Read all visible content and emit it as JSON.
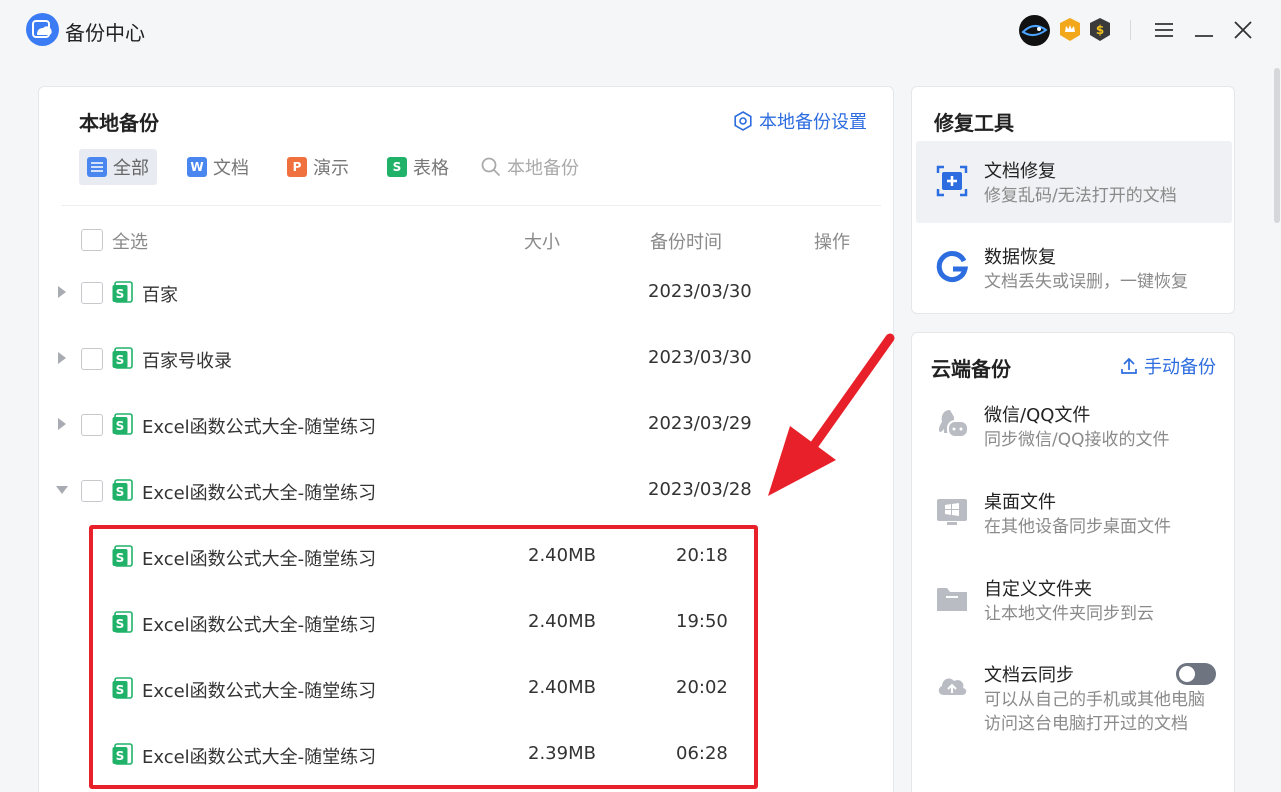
{
  "app": {
    "title": "备份中心"
  },
  "main": {
    "title": "本地备份",
    "settings_label": "本地备份设置",
    "filters": [
      {
        "label": "全部",
        "icon": "list-icon",
        "color": "#4a86f0"
      },
      {
        "label": "文档",
        "icon": "writer-icon",
        "color": "#4a86f0"
      },
      {
        "label": "演示",
        "icon": "presentation-icon",
        "color": "#f0703e"
      },
      {
        "label": "表格",
        "icon": "spreadsheet-icon",
        "color": "#21b26a"
      }
    ],
    "search_placeholder": "本地备份",
    "columns": {
      "select_all": "全选",
      "size": "大小",
      "time": "备份时间",
      "action": "操作"
    },
    "rows": [
      {
        "name": "百家",
        "date": "2023/03/30",
        "expanded": false
      },
      {
        "name": "百家号收录",
        "date": "2023/03/30",
        "expanded": false
      },
      {
        "name": "Excel函数公式大全-随堂练习",
        "date": "2023/03/29",
        "expanded": false
      },
      {
        "name": "Excel函数公式大全-随堂练习",
        "date": "2023/03/28",
        "expanded": true
      }
    ],
    "sub_rows": [
      {
        "name": "Excel函数公式大全-随堂练习",
        "size": "2.40MB",
        "time": "20:18"
      },
      {
        "name": "Excel函数公式大全-随堂练习",
        "size": "2.40MB",
        "time": "19:50"
      },
      {
        "name": "Excel函数公式大全-随堂练习",
        "size": "2.40MB",
        "time": "20:02"
      },
      {
        "name": "Excel函数公式大全-随堂练习",
        "size": "2.39MB",
        "time": "06:28"
      }
    ]
  },
  "repair": {
    "title": "修复工具",
    "items": [
      {
        "title": "文档修复",
        "desc": "修复乱码/无法打开的文档"
      },
      {
        "title": "数据恢复",
        "desc": "文档丢失或误删，一键恢复"
      }
    ]
  },
  "cloud": {
    "title": "云端备份",
    "manual_label": "手动备份",
    "items": [
      {
        "title": "微信/QQ文件",
        "desc": "同步微信/QQ接收的文件"
      },
      {
        "title": "桌面文件",
        "desc": "在其他设备同步桌面文件"
      },
      {
        "title": "自定义文件夹",
        "desc": "让本地文件夹同步到云"
      },
      {
        "title": "文档云同步",
        "desc": "可以从自己的手机或其他电脑",
        "desc2": "访问这台电脑打开过的文档",
        "toggle_on": false
      }
    ]
  },
  "colors": {
    "accent": "#2d6de0",
    "annotation": "#e8202a",
    "spreadsheet": "#21b26a"
  }
}
